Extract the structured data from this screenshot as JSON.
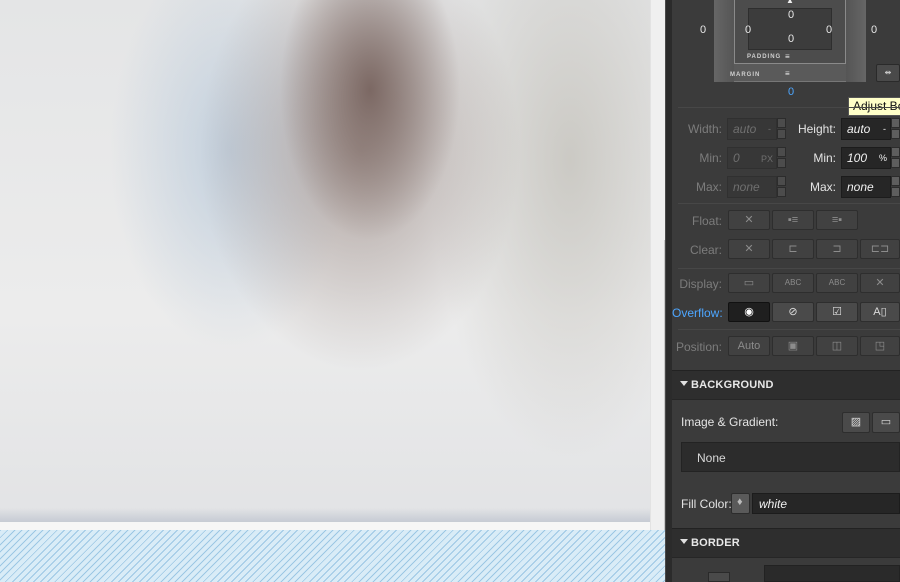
{
  "box_model": {
    "margin_label": "MARGIN",
    "padding_label": "PADDING",
    "margin_left": "0",
    "margin_right": "0",
    "margin_bottom": "0",
    "padding_top": "0",
    "padding_left": "0",
    "padding_right": "0",
    "padding_bottom": "0",
    "content_top": "0",
    "tooltip": "Adjust Bo"
  },
  "dimensions": {
    "width_label": "Width:",
    "width_value": "auto",
    "height_label": "Height:",
    "height_value": "auto",
    "min_w_label": "Min:",
    "min_w_value": "0",
    "min_w_unit": "PX",
    "min_h_label": "Min:",
    "min_h_value": "100",
    "min_h_unit": "%",
    "max_w_label": "Max:",
    "max_w_value": "none",
    "max_h_label": "Max:",
    "max_h_value": "none",
    "height_unit": "-"
  },
  "layout": {
    "float_label": "Float:",
    "clear_label": "Clear:",
    "display_label": "Display:",
    "overflow_label": "Overflow:",
    "position_label": "Position:",
    "position_auto": "Auto",
    "x_glyph": "✕",
    "abc_glyph": "ABC"
  },
  "background": {
    "title": "BACKGROUND",
    "image_gradient_label": "Image & Gradient:",
    "image_value": "None",
    "fill_label": "Fill Color:",
    "fill_value": "white"
  },
  "border": {
    "title": "BORDER"
  },
  "colors": {
    "accent_blue": "#4da6ff",
    "panel_bg": "#3b3b3b",
    "tooltip_bg": "#ffffc8"
  }
}
